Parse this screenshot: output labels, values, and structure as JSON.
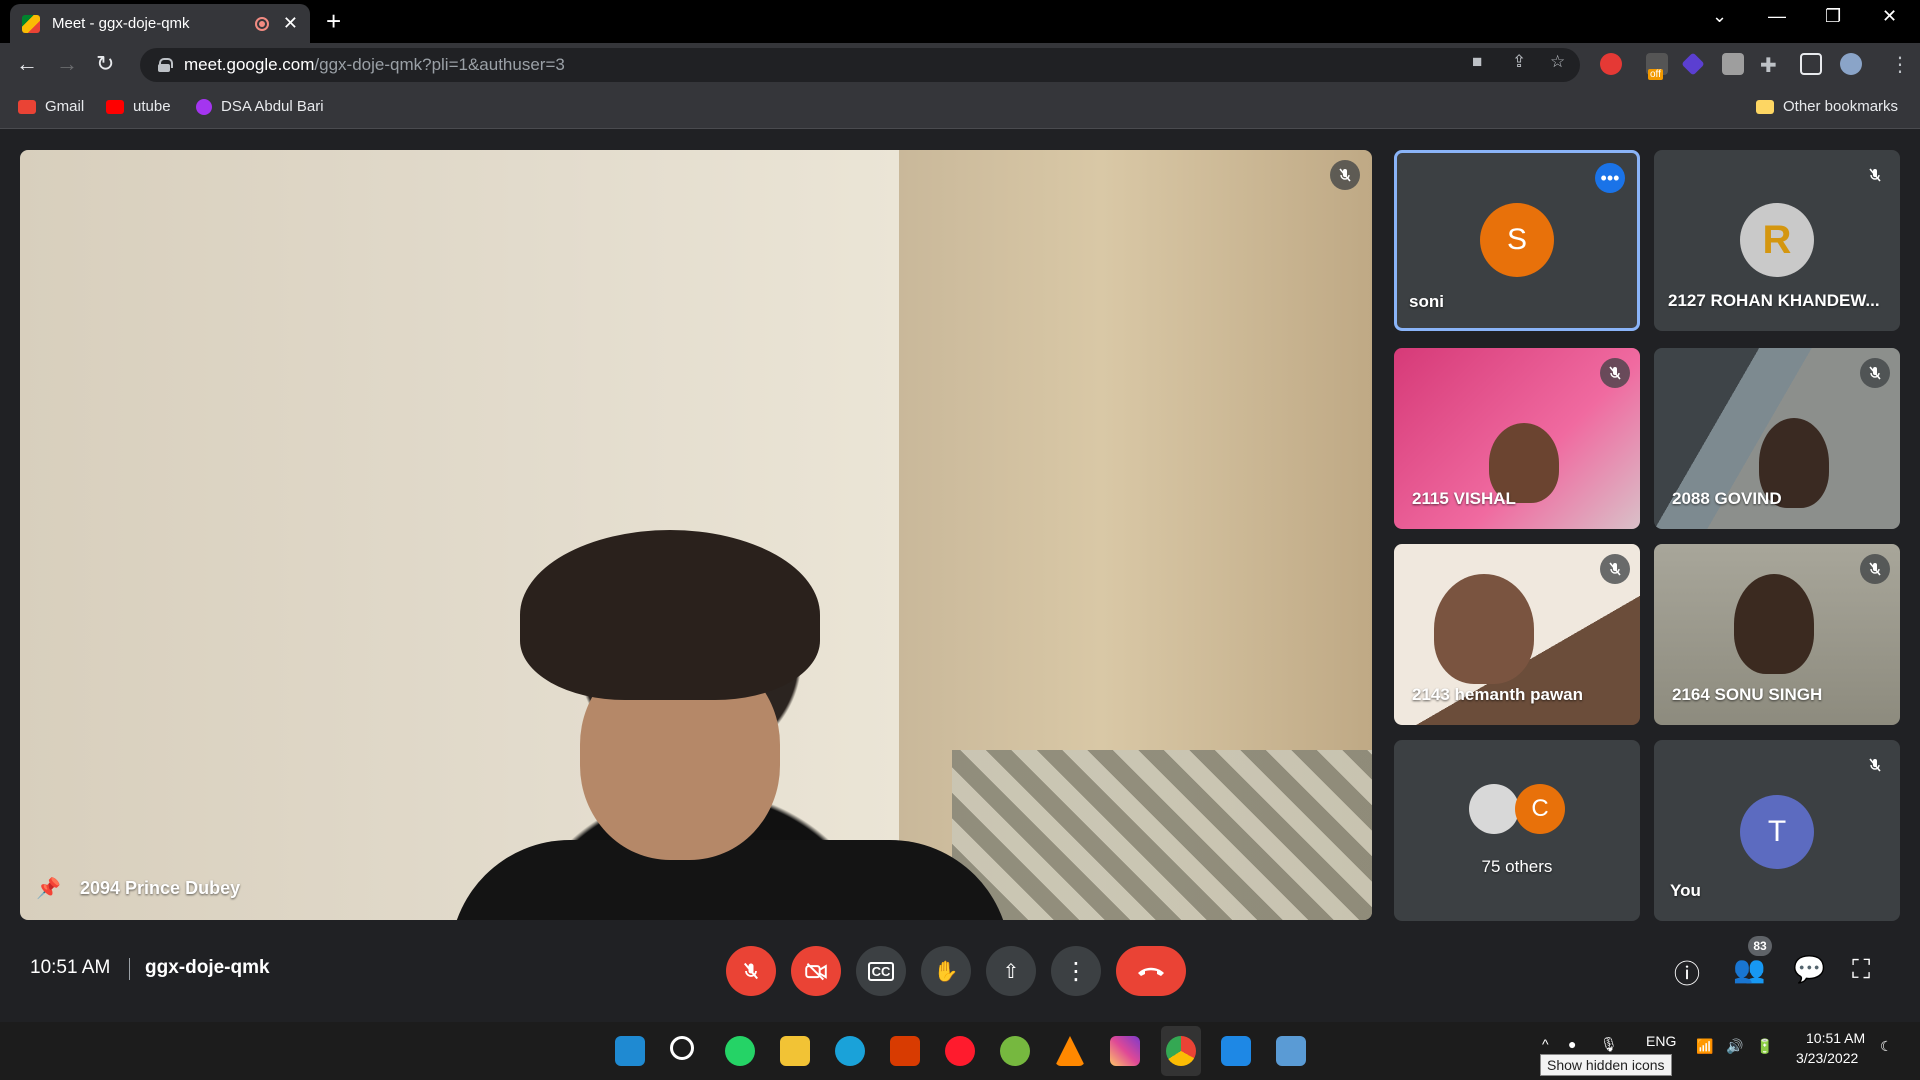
{
  "browser": {
    "tab_title": "Meet - ggx-doje-qmk",
    "url_host": "meet.google.com",
    "url_path": "/ggx-doje-qmk?pli=1&authuser=3",
    "ext_badge": "off"
  },
  "bookmarks": {
    "items": [
      {
        "label": "Gmail",
        "icon": "gmail-icon",
        "color": "#ea4335"
      },
      {
        "label": "utube",
        "icon": "youtube-icon",
        "color": "#ff0000"
      },
      {
        "label": "DSA Abdul Bari",
        "icon": "udemy-icon",
        "color": "#a435f0"
      }
    ],
    "other": "Other bookmarks"
  },
  "meet": {
    "main_tile": {
      "name": "2094 Prince Dubey",
      "pinned": true
    },
    "tiles": [
      {
        "name": "soni",
        "avatar_letter": "S",
        "avatar_color": "#e8710a",
        "active_speaker": true
      },
      {
        "name": "2127 ROHAN KHANDEW...",
        "avatar_letter": "R",
        "avatar_color": "#b06000",
        "muted": true
      },
      {
        "name": "2115 VISHAL",
        "muted": true
      },
      {
        "name": "2088 GOVIND",
        "muted": true
      },
      {
        "name": "2143 hemanth pawan",
        "muted": true
      },
      {
        "name": "2164 SONU SINGH",
        "muted": true
      },
      {
        "name": "75 others",
        "mini_avatar_letter": "C",
        "mini_avatar_color": "#e8710a"
      },
      {
        "name": "You",
        "avatar_letter": "T",
        "avatar_color": "#5c6bc0",
        "muted": true
      }
    ],
    "time": "10:51 AM",
    "meeting_code": "ggx-doje-qmk",
    "participant_count": "83",
    "accent_red": "#ea4335",
    "accent_blue": "#8ab4f8"
  },
  "taskbar": {
    "lang": "ENG",
    "clock_time": "10:51 AM",
    "clock_date": "3/23/2022",
    "tooltip": "Show hidden icons"
  }
}
